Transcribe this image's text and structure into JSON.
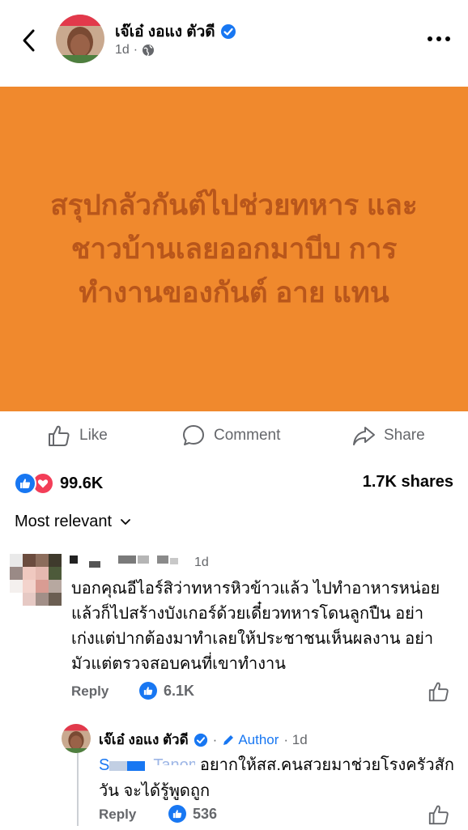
{
  "header": {
    "back_icon": "chevron-left-icon",
    "author": "เจ๊เอ๋ งอแง ตัวดี",
    "time": "1d",
    "privacy_icon": "globe-icon",
    "more_icon": "more-horizontal-icon"
  },
  "post": {
    "background_color": "#f0892d",
    "text_color": "#b8561b",
    "text": "สรุปกลัวกันต์ไปช่วยทหาร และชาวบ้านเลยออกมาบีบ การทำงานของกันต์ อาย แทน"
  },
  "actions": {
    "like_label": "Like",
    "comment_label": "Comment",
    "share_label": "Share"
  },
  "stats": {
    "reaction_count": "99.6K",
    "shares": "1.7K shares"
  },
  "sort_label": "Most relevant",
  "comments": [
    {
      "time": "1d",
      "text": "บอกคุณอีไอร์สิว่าทหารหิวข้าวแล้ว ไปทำอาหารหน่อยแล้วก็ไปสร้างบังเกอร์ด้วยเดี๋ยวทหารโดนลูกปืน อย่าเก่งแต่ปากต้องมาทำเลยให้ประชาชนเห็นผลงาน อย่ามัวแต่ตรวจสอบคนที่เขาทำงาน",
      "reply_label": "Reply",
      "like_count": "6.1K"
    }
  ],
  "reply": {
    "author": "เจ๊เอ๋ งอแง ตัวดี",
    "author_badge": "Author",
    "time": "· 1d",
    "mention_prefix": "S",
    "mention_suffix": "Tanom",
    "text": "อยากให้สส.คนสวยมาช่วยโรงครัวสักวัน จะได้รู้พูดถูก",
    "reply_label": "Reply",
    "like_count": "536"
  },
  "colors": {
    "accent": "#1877f2",
    "love": "#f33e58",
    "muted": "#65676b"
  }
}
